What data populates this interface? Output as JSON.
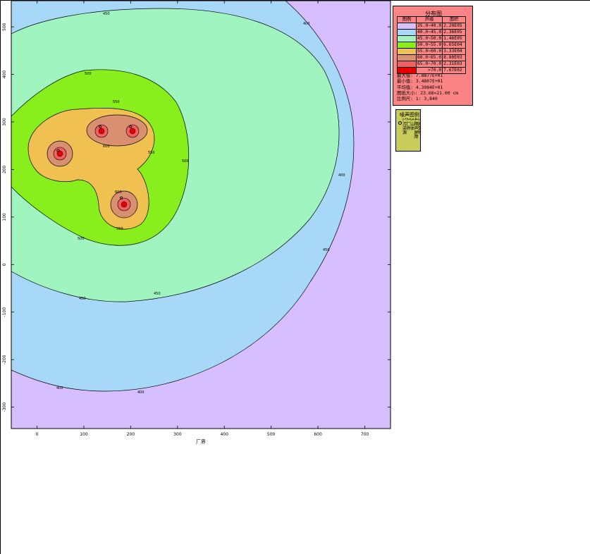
{
  "chart_data": {
    "type": "contour",
    "title": "",
    "xlabel": "厂界",
    "ylabel": "",
    "xlim": [
      -55,
      755
    ],
    "ylim": [
      -345,
      555
    ],
    "x_ticks": [
      "0",
      "100",
      "200",
      "300",
      "400",
      "500",
      "600",
      "700"
    ],
    "x_tick_values": [
      0,
      100,
      200,
      300,
      400,
      500,
      600,
      700
    ],
    "y_ticks": [
      "500",
      "400",
      "300",
      "200",
      "100",
      "0",
      "-100",
      "-200",
      "-300"
    ],
    "y_tick_values": [
      500,
      400,
      300,
      200,
      100,
      0,
      -100,
      -200,
      -300
    ],
    "sources": [
      {
        "x": 45,
        "y": 240
      },
      {
        "x": 135,
        "y": 290
      },
      {
        "x": 200,
        "y": 290
      },
      {
        "x": 180,
        "y": 140
      }
    ],
    "contour_levels": [
      40,
      45,
      50,
      55,
      60,
      65,
      70
    ],
    "contour_labels": [
      "400",
      "450",
      "500",
      "550",
      "600",
      "650",
      "700"
    ],
    "band_colors": [
      "#d6beff",
      "#a8d8f8",
      "#a0f4c0",
      "#88ee1c",
      "#f0c050",
      "#d89070",
      "#f06060",
      "#e80000"
    ]
  },
  "distribution": {
    "title": "分布图",
    "headers": [
      "图例",
      "声级",
      "面积"
    ],
    "rows": [
      {
        "color": "#d6beff",
        "range": "35.0~40.0",
        "area": "2.20E05"
      },
      {
        "color": "#a8d8f8",
        "range": "40.0~45.0",
        "area": "2.36E05"
      },
      {
        "color": "#a0f4c0",
        "range": "45.0~50.0",
        "area": "1.46E05"
      },
      {
        "color": "#88ee1c",
        "range": "50.0~55.0",
        "area": "6.65E04"
      },
      {
        "color": "#f0c050",
        "range": "55.0~60.0",
        "area": "3.33E04"
      },
      {
        "color": "#d89070",
        "range": "60.0~65.0",
        "area": "8.80E03"
      },
      {
        "color": "#f06060",
        "range": "65.0~70.0",
        "area": "2.31E03"
      },
      {
        "color": "#e80000",
        "range": ">70.0",
        "area": "7.67E02"
      }
    ],
    "stats": [
      {
        "label": "最大值:",
        "value": "7.8877E+01"
      },
      {
        "label": "最小值:",
        "value": "3.4807E+01"
      },
      {
        "label": "平均值:",
        "value": "4.3984E+01"
      },
      {
        "label": "图纸大小:",
        "value": "23.68×21.00 cm"
      },
      {
        "label": "比例尺:",
        "value": "1: 3,840"
      }
    ]
  },
  "sources_legend": {
    "title": "噪声图例",
    "items": [
      "1.污染源",
      "2.厂界",
      "3.山体",
      "4.隔声屏障",
      "5.建筑物"
    ]
  }
}
